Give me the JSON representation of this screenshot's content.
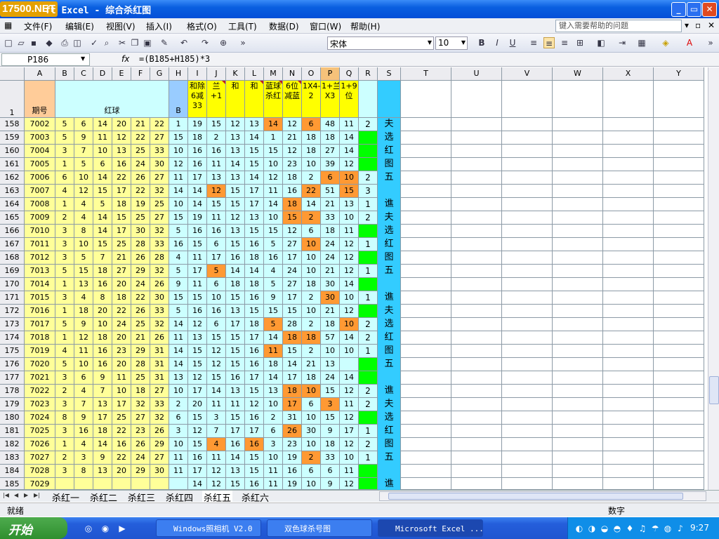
{
  "app": {
    "brand": "17500.NET",
    "title": "ft Excel - 综合杀红图"
  },
  "menu": [
    "文件(F)",
    "编辑(E)",
    "视图(V)",
    "插入(I)",
    "格式(O)",
    "工具(T)",
    "数据(D)",
    "窗口(W)",
    "帮助(H)"
  ],
  "help_placeholder": "键入需要帮助的问题",
  "font": "宋体",
  "font_size": "10",
  "cell_ref": "P186",
  "formula": "=(B185+H185)*3",
  "columns": [
    "A",
    "B",
    "C",
    "D",
    "E",
    "F",
    "G",
    "H",
    "I",
    "J",
    "K",
    "L",
    "M",
    "N",
    "O",
    "P",
    "Q",
    "R",
    "S",
    "T",
    "U",
    "V",
    "W",
    "X",
    "Y"
  ],
  "header_row": {
    "num": "1",
    "A": "期号",
    "B_G": "红球",
    "H": "B",
    "I": "和除6减33",
    "J": "兰+1",
    "K": "和",
    "L": "和",
    "M": "蓝球杀红",
    "N": "6位减蓝",
    "O": "1X4-2",
    "P": "1+兰X3",
    "Q": "1+9位"
  },
  "rows": [
    {
      "n": "158",
      "id": "7002",
      "red": [
        "5",
        "6",
        "14",
        "20",
        "21",
        "22"
      ],
      "b": "1",
      "i": "19",
      "j": "15",
      "k": "12",
      "l": "13",
      "m": "14",
      "nn": "12",
      "o": "6",
      "p": "48",
      "q": "11",
      "r": "2",
      "s": "夫"
    },
    {
      "n": "159",
      "id": "7003",
      "red": [
        "5",
        "9",
        "11",
        "12",
        "22",
        "27"
      ],
      "b": "15",
      "i": "18",
      "j": "2",
      "k": "13",
      "l": "14",
      "m": "1",
      "nn": "21",
      "o": "18",
      "p": "18",
      "q": "14",
      "r": "",
      "s": "选"
    },
    {
      "n": "160",
      "id": "7004",
      "red": [
        "3",
        "7",
        "10",
        "13",
        "25",
        "33"
      ],
      "b": "10",
      "i": "16",
      "j": "16",
      "k": "13",
      "l": "15",
      "m": "15",
      "nn": "12",
      "o": "18",
      "p": "27",
      "q": "14",
      "r": "",
      "s": "红"
    },
    {
      "n": "161",
      "id": "7005",
      "red": [
        "1",
        "5",
        "6",
        "16",
        "24",
        "30"
      ],
      "b": "12",
      "i": "16",
      "j": "11",
      "k": "14",
      "l": "15",
      "m": "10",
      "nn": "23",
      "o": "10",
      "p": "39",
      "q": "12",
      "r": "",
      "s": "图"
    },
    {
      "n": "162",
      "id": "7006",
      "red": [
        "6",
        "10",
        "14",
        "22",
        "26",
        "27"
      ],
      "b": "11",
      "i": "17",
      "j": "13",
      "k": "13",
      "l": "14",
      "m": "12",
      "nn": "18",
      "o": "2",
      "p": "6",
      "q": "10",
      "r": "2",
      "s": "五"
    },
    {
      "n": "163",
      "id": "7007",
      "red": [
        "4",
        "12",
        "15",
        "17",
        "22",
        "32"
      ],
      "b": "14",
      "i": "14",
      "j": "12",
      "k": "15",
      "l": "17",
      "m": "11",
      "nn": "16",
      "o": "22",
      "p": "51",
      "q": "15",
      "r": "3",
      "s": ""
    },
    {
      "n": "164",
      "id": "7008",
      "red": [
        "1",
        "4",
        "5",
        "18",
        "19",
        "25"
      ],
      "b": "10",
      "i": "14",
      "j": "15",
      "k": "15",
      "l": "17",
      "m": "14",
      "nn": "18",
      "o": "14",
      "p": "21",
      "q": "13",
      "r": "1",
      "s": "谯"
    },
    {
      "n": "165",
      "id": "7009",
      "red": [
        "2",
        "4",
        "14",
        "15",
        "25",
        "27"
      ],
      "b": "15",
      "i": "19",
      "j": "11",
      "k": "12",
      "l": "13",
      "m": "10",
      "nn": "15",
      "o": "2",
      "p": "33",
      "q": "10",
      "r": "2",
      "s": "夫"
    },
    {
      "n": "166",
      "id": "7010",
      "red": [
        "3",
        "8",
        "14",
        "17",
        "30",
        "32"
      ],
      "b": "5",
      "i": "16",
      "j": "16",
      "k": "13",
      "l": "15",
      "m": "15",
      "nn": "12",
      "o": "6",
      "p": "18",
      "q": "11",
      "r": "",
      "s": "选"
    },
    {
      "n": "167",
      "id": "7011",
      "red": [
        "3",
        "10",
        "15",
        "25",
        "28",
        "33"
      ],
      "b": "16",
      "i": "15",
      "j": "6",
      "k": "15",
      "l": "16",
      "m": "5",
      "nn": "27",
      "o": "10",
      "p": "24",
      "q": "12",
      "r": "1",
      "s": "红"
    },
    {
      "n": "168",
      "id": "7012",
      "red": [
        "3",
        "5",
        "7",
        "21",
        "26",
        "28"
      ],
      "b": "4",
      "i": "11",
      "j": "17",
      "k": "16",
      "l": "18",
      "m": "16",
      "nn": "17",
      "o": "10",
      "p": "24",
      "q": "12",
      "r": "",
      "s": "图"
    },
    {
      "n": "169",
      "id": "7013",
      "red": [
        "5",
        "15",
        "18",
        "27",
        "29",
        "32"
      ],
      "b": "5",
      "i": "17",
      "j": "5",
      "k": "14",
      "l": "14",
      "m": "4",
      "nn": "24",
      "o": "10",
      "p": "21",
      "q": "12",
      "r": "1",
      "s": "五"
    },
    {
      "n": "170",
      "id": "7014",
      "red": [
        "1",
        "13",
        "16",
        "20",
        "24",
        "26"
      ],
      "b": "9",
      "i": "11",
      "j": "6",
      "k": "18",
      "l": "18",
      "m": "5",
      "nn": "27",
      "o": "18",
      "p": "30",
      "q": "14",
      "r": "",
      "s": ""
    },
    {
      "n": "171",
      "id": "7015",
      "red": [
        "3",
        "4",
        "8",
        "18",
        "22",
        "30"
      ],
      "b": "15",
      "i": "15",
      "j": "10",
      "k": "15",
      "l": "16",
      "m": "9",
      "nn": "17",
      "o": "2",
      "p": "30",
      "q": "10",
      "r": "1",
      "s": "谯"
    },
    {
      "n": "172",
      "id": "7016",
      "red": [
        "1",
        "18",
        "20",
        "22",
        "26",
        "33"
      ],
      "b": "5",
      "i": "16",
      "j": "16",
      "k": "13",
      "l": "15",
      "m": "15",
      "nn": "15",
      "o": "10",
      "p": "21",
      "q": "12",
      "r": "",
      "s": "夫"
    },
    {
      "n": "173",
      "id": "7017",
      "red": [
        "5",
        "9",
        "10",
        "24",
        "25",
        "32"
      ],
      "b": "14",
      "i": "12",
      "j": "6",
      "k": "17",
      "l": "18",
      "m": "5",
      "nn": "28",
      "o": "2",
      "p": "18",
      "q": "10",
      "r": "2",
      "s": "选"
    },
    {
      "n": "174",
      "id": "7018",
      "red": [
        "1",
        "12",
        "18",
        "20",
        "21",
        "26"
      ],
      "b": "11",
      "i": "13",
      "j": "15",
      "k": "15",
      "l": "17",
      "m": "14",
      "nn": "18",
      "o": "18",
      "p": "57",
      "q": "14",
      "r": "2",
      "s": "红"
    },
    {
      "n": "175",
      "id": "7019",
      "red": [
        "4",
        "11",
        "16",
        "23",
        "29",
        "31"
      ],
      "b": "14",
      "i": "15",
      "j": "12",
      "k": "15",
      "l": "16",
      "m": "11",
      "nn": "15",
      "o": "2",
      "p": "10",
      "q": "10",
      "r": "1",
      "s": "图"
    },
    {
      "n": "176",
      "id": "7020",
      "red": [
        "5",
        "10",
        "16",
        "20",
        "28",
        "31"
      ],
      "b": "14",
      "i": "15",
      "j": "12",
      "k": "15",
      "l": "16",
      "m": "18",
      "nn": "14",
      "o": "21",
      "p": "13",
      "q": "",
      "r": "",
      "s": "五"
    },
    {
      "n": "177",
      "id": "7021",
      "red": [
        "3",
        "6",
        "9",
        "11",
        "25",
        "31"
      ],
      "b": "13",
      "i": "12",
      "j": "15",
      "k": "16",
      "l": "17",
      "m": "14",
      "nn": "17",
      "o": "18",
      "p": "24",
      "q": "14",
      "r": "",
      "s": ""
    },
    {
      "n": "178",
      "id": "7022",
      "red": [
        "2",
        "4",
        "7",
        "10",
        "18",
        "27"
      ],
      "b": "10",
      "i": "17",
      "j": "14",
      "k": "13",
      "l": "15",
      "m": "13",
      "nn": "18",
      "o": "10",
      "p": "15",
      "q": "12",
      "r": "2",
      "s": "谯"
    },
    {
      "n": "179",
      "id": "7023",
      "red": [
        "3",
        "7",
        "13",
        "17",
        "32",
        "33"
      ],
      "b": "2",
      "i": "20",
      "j": "11",
      "k": "11",
      "l": "12",
      "m": "10",
      "nn": "17",
      "o": "6",
      "p": "3",
      "q": "11",
      "r": "2",
      "s": "夫"
    },
    {
      "n": "180",
      "id": "7024",
      "red": [
        "8",
        "9",
        "17",
        "25",
        "27",
        "32"
      ],
      "b": "6",
      "i": "15",
      "j": "3",
      "k": "15",
      "l": "16",
      "m": "2",
      "nn": "31",
      "o": "10",
      "p": "15",
      "q": "12",
      "r": "",
      "s": "选"
    },
    {
      "n": "181",
      "id": "7025",
      "red": [
        "3",
        "16",
        "18",
        "22",
        "23",
        "26"
      ],
      "b": "3",
      "i": "12",
      "j": "7",
      "k": "17",
      "l": "17",
      "m": "6",
      "nn": "26",
      "o": "30",
      "p": "9",
      "q": "17",
      "r": "1",
      "s": "红"
    },
    {
      "n": "182",
      "id": "7026",
      "red": [
        "1",
        "4",
        "14",
        "16",
        "26",
        "29"
      ],
      "b": "10",
      "i": "15",
      "j": "4",
      "k": "16",
      "l": "16",
      "m": "3",
      "nn": "23",
      "o": "10",
      "p": "18",
      "q": "12",
      "r": "2",
      "s": "图"
    },
    {
      "n": "183",
      "id": "7027",
      "red": [
        "2",
        "3",
        "9",
        "22",
        "24",
        "27"
      ],
      "b": "11",
      "i": "16",
      "j": "11",
      "k": "14",
      "l": "15",
      "m": "10",
      "nn": "19",
      "o": "2",
      "p": "33",
      "q": "10",
      "r": "1",
      "s": "五"
    },
    {
      "n": "184",
      "id": "7028",
      "red": [
        "3",
        "8",
        "13",
        "20",
        "29",
        "30"
      ],
      "b": "11",
      "i": "17",
      "j": "12",
      "k": "13",
      "l": "15",
      "m": "11",
      "nn": "16",
      "o": "6",
      "p": "6",
      "q": "11",
      "r": "",
      "s": ""
    },
    {
      "n": "185",
      "id": "7029",
      "red": [
        "",
        "",
        "",
        "",
        "",
        ""
      ],
      "b": "",
      "i": "14",
      "j": "12",
      "k": "15",
      "l": "16",
      "m": "11",
      "nn": "19",
      "o": "10",
      "p": "9",
      "q": "12",
      "r": "",
      "s": "谯"
    }
  ],
  "highlights": {
    "158": [
      "M",
      "O"
    ],
    "162": [
      "P",
      "Q"
    ],
    "163": [
      "J",
      "O",
      "Q"
    ],
    "164": [
      "N"
    ],
    "165": [
      "N",
      "O"
    ],
    "167": [
      "O"
    ],
    "169": [
      "J"
    ],
    "171": [
      "P"
    ],
    "173": [
      "M",
      "Q"
    ],
    "174": [
      "N",
      "O"
    ],
    "175": [
      "M"
    ],
    "178": [
      "N",
      "O"
    ],
    "179": [
      "N",
      "P"
    ],
    "181": [
      "N"
    ],
    "182": [
      "J",
      "L"
    ],
    "183": [
      "O"
    ]
  },
  "green_r": [
    "159",
    "160",
    "161",
    "166",
    "168",
    "170",
    "172",
    "176",
    "177",
    "180",
    "184",
    "185"
  ],
  "tabs": [
    "杀红一",
    "杀红二",
    "杀红三",
    "杀红四",
    "杀红五",
    "杀红六"
  ],
  "active_tab": "杀红五",
  "status": "就绪",
  "num_indicator": "数字",
  "taskbar": {
    "start": "开始",
    "items": [
      "Windows照相机 V2.0",
      "双色球杀号图",
      "Microsoft Excel ..."
    ],
    "clock": "9:27"
  },
  "colors": {
    "yellow_cells": "#ffff99",
    "blue_cells": "#ccffff",
    "highlight": "#ff9933",
    "green": "#00ff00",
    "aqua": "#33ccff",
    "header_yellow": "#ffff00",
    "header_pink": "#ffcc99"
  }
}
